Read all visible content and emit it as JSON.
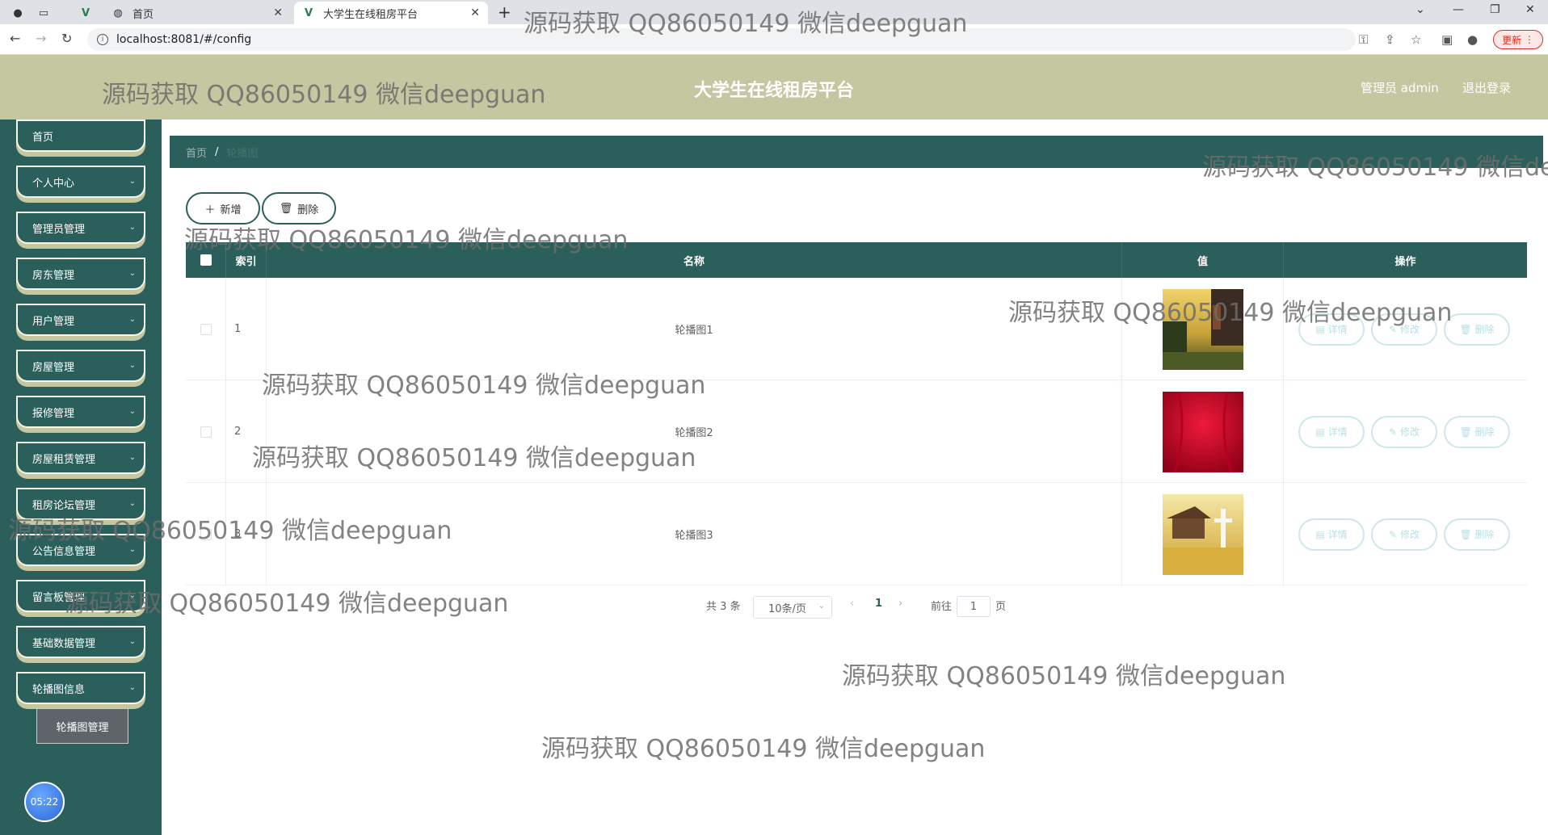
{
  "browser": {
    "tabs": [
      {
        "label": "首页",
        "icon": "globe-icon"
      },
      {
        "label": "大学生在线租房平台",
        "icon": "vue-logo-icon"
      }
    ],
    "url": "localhost:8081/#/config",
    "update_label": "更新"
  },
  "header": {
    "title": "大学生在线租房平台",
    "user": "管理员 admin",
    "logout": "退出登录"
  },
  "sidebar": {
    "items": [
      {
        "label": "首页",
        "has_children": false
      },
      {
        "label": "个人中心",
        "has_children": true
      },
      {
        "label": "管理员管理",
        "has_children": true
      },
      {
        "label": "房东管理",
        "has_children": true
      },
      {
        "label": "用户管理",
        "has_children": true
      },
      {
        "label": "房屋管理",
        "has_children": true
      },
      {
        "label": "报修管理",
        "has_children": true
      },
      {
        "label": "房屋租赁管理",
        "has_children": true
      },
      {
        "label": "租房论坛管理",
        "has_children": true
      },
      {
        "label": "公告信息管理",
        "has_children": true
      },
      {
        "label": "留言板管理",
        "has_children": true
      },
      {
        "label": "基础数据管理",
        "has_children": true
      },
      {
        "label": "轮播图信息",
        "has_children": true
      }
    ],
    "submenu_active": "轮播图管理",
    "clock": "05:22"
  },
  "breadcrumb": {
    "home": "首页",
    "separator": "/",
    "current": "轮播图"
  },
  "toolbar": {
    "add_label": "新增",
    "delete_label": "删除"
  },
  "table": {
    "headers": {
      "index": "索引",
      "name": "名称",
      "value": "值",
      "actions": "操作"
    },
    "rows": [
      {
        "index": "1",
        "name": "轮播图1",
        "image": "garden-pavilion-photo"
      },
      {
        "index": "2",
        "name": "轮播图2",
        "image": "red-curtain-photo"
      },
      {
        "index": "3",
        "name": "轮播图3",
        "image": "temple-statue-photo"
      }
    ],
    "actions": {
      "detail": "详情",
      "edit": "修改",
      "delete": "删除"
    }
  },
  "pagination": {
    "total": "共 3 条",
    "page_size": "10条/页",
    "current_page": "1",
    "goto_label": "前往",
    "goto_value": "1",
    "page_suffix": "页"
  },
  "watermark": "源码获取 QQ86050149 微信deepguan",
  "colors": {
    "primary": "#2b5f5b",
    "header": "#c5c7a1",
    "accent": "#cde7eb"
  }
}
